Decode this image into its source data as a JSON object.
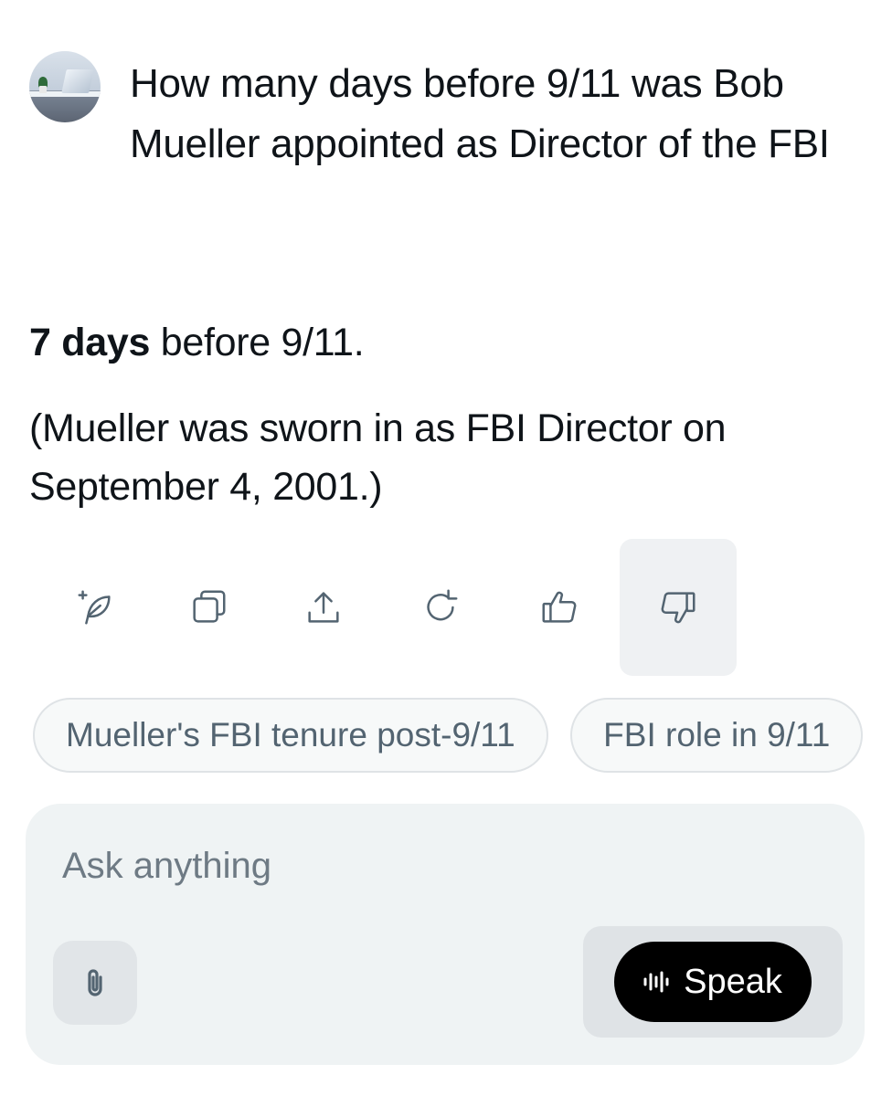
{
  "user_message": {
    "text": "How many days before 9/11 was Bob Mueller appointed as Director of the FBI"
  },
  "response": {
    "answer_bold": "7 days",
    "answer_rest": " before 9/11.",
    "detail": "(Mueller was sworn in as FBI Director on September 4, 2001.)"
  },
  "actions": [
    {
      "name": "edit-icon",
      "active": false
    },
    {
      "name": "copy-icon",
      "active": false
    },
    {
      "name": "share-icon",
      "active": false
    },
    {
      "name": "regenerate-icon",
      "active": false
    },
    {
      "name": "thumbs-up-icon",
      "active": false
    },
    {
      "name": "thumbs-down-icon",
      "active": true
    }
  ],
  "suggestions": [
    "Mueller's FBI tenure post-9/11",
    "FBI role in 9/11"
  ],
  "composer": {
    "placeholder": "Ask anything",
    "speak_label": "Speak"
  },
  "colors": {
    "icon_gray": "#536471",
    "composer_bg": "#eff3f4",
    "speak_bg": "#000000"
  }
}
